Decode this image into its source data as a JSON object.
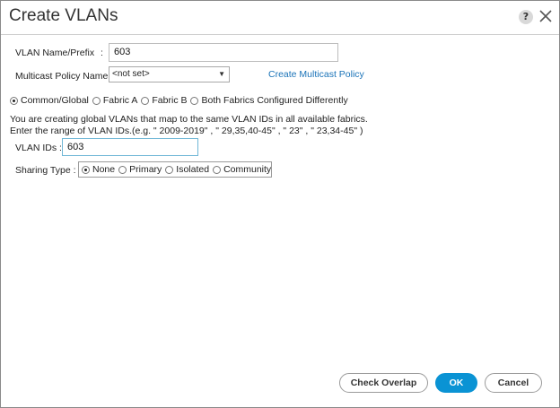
{
  "dialog": {
    "title": "Create VLANs",
    "help_icon": "?",
    "close_icon": "close-icon"
  },
  "form": {
    "vlan_name_label": "VLAN Name/Prefix",
    "vlan_name_colon": ":",
    "vlan_name_value": "603",
    "multicast_label": "Multicast Policy Name :",
    "multicast_selected": "<not set>",
    "create_multicast_link": "Create Multicast Policy",
    "fabric_options": [
      {
        "label": "Common/Global",
        "selected": true
      },
      {
        "label": "Fabric A",
        "selected": false
      },
      {
        "label": "Fabric B",
        "selected": false
      },
      {
        "label": "Both Fabrics Configured Differently",
        "selected": false
      }
    ],
    "info_line1": "You are creating global VLANs that map to the same VLAN IDs in all available fabrics.",
    "info_line2": "Enter the range of VLAN IDs.(e.g. \" 2009-2019\" , \" 29,35,40-45\" , \" 23\" , \" 23,34-45\" )",
    "vlan_ids_label": "VLAN IDs :",
    "vlan_ids_value": "603",
    "sharing_label": "Sharing Type  :",
    "sharing_options": [
      {
        "label": "None",
        "selected": true
      },
      {
        "label": "Primary",
        "selected": false
      },
      {
        "label": "Isolated",
        "selected": false
      },
      {
        "label": "Community",
        "selected": false
      }
    ]
  },
  "buttons": {
    "check_overlap": "Check Overlap",
    "ok": "OK",
    "cancel": "Cancel"
  },
  "colors": {
    "primary_button": "#0a93d4",
    "link": "#1a73b8",
    "focus_border": "#6fb7d6"
  }
}
